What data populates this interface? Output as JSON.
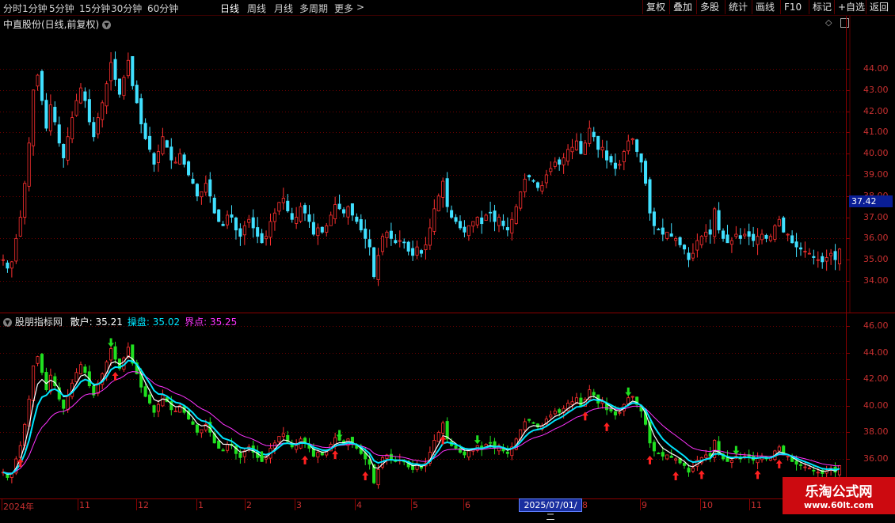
{
  "toolbar": {
    "periods": [
      "分时",
      "1分钟",
      "5分钟",
      "15分钟",
      "30分钟",
      "60分钟",
      "日线",
      "周线",
      "月线",
      "多周期",
      "更多"
    ],
    "active_period": "日线",
    "more_arrow": ">",
    "right_buttons": [
      "复权",
      "叠加",
      "多股",
      "统计",
      "画线",
      "F10",
      "标记",
      "+自选",
      "返回"
    ]
  },
  "main_chart": {
    "title": "中直股份(日线,前复权)",
    "y_ticks": [
      "44.00",
      "43.00",
      "42.00",
      "41.00",
      "40.00",
      "39.00",
      "38.00",
      "37.00",
      "36.00",
      "35.00",
      "34.00"
    ],
    "current_price": "37.42"
  },
  "indicator": {
    "name": "股朋指标网",
    "series": [
      {
        "label": "散户:",
        "value": "35.21",
        "color": "#ffffff"
      },
      {
        "label": "操盘:",
        "value": "35.02",
        "color": "#00e5ff"
      },
      {
        "label": "界点:",
        "value": "35.25",
        "color": "#ff33ff"
      }
    ],
    "y_ticks": [
      "46.00",
      "44.00",
      "42.00",
      "40.00",
      "38.00",
      "36.00"
    ]
  },
  "x_axis": {
    "labels": [
      "2024年",
      "11",
      "12",
      "1",
      "2",
      "3",
      "4",
      "5",
      "6",
      "7",
      "8",
      "9",
      "10",
      "11"
    ],
    "cursor_date": "2025/07/01/二"
  },
  "watermark": {
    "line1": "乐淘公式网",
    "line2": "www.60lt.com"
  },
  "colors": {
    "up": "#ff3030",
    "down": "#40e0ff",
    "grid": "#6e0000",
    "white_line": "#ffffff",
    "cyan_line": "#00e5ff",
    "magenta_line": "#ff33ff",
    "signal_up": "#ff2020",
    "signal_down": "#20e020"
  },
  "chart_data": {
    "type": "candlestick",
    "price_path": [
      35.0,
      34.6,
      34.9,
      36.0,
      37.0,
      38.6,
      40.5,
      43.0,
      43.7,
      42.5,
      41.2,
      42.3,
      41.5,
      40.5,
      39.8,
      40.8,
      41.7,
      42.5,
      43.1,
      42.5,
      41.5,
      40.8,
      41.7,
      42.4,
      43.3,
      44.3,
      43.5,
      42.8,
      43.6,
      44.4,
      43.2,
      42.4,
      41.4,
      40.7,
      40.2,
      39.5,
      40.1,
      40.8,
      40.3,
      39.7,
      39.6,
      40.0,
      39.5,
      39.0,
      38.6,
      38.0,
      38.2,
      38.6,
      38.0,
      37.2,
      36.8,
      36.6,
      37.1,
      37.0,
      36.4,
      36.1,
      36.6,
      36.9,
      36.5,
      36.1,
      35.8,
      36.1,
      36.8,
      37.2,
      37.7,
      37.9,
      37.3,
      36.9,
      37.0,
      37.5,
      37.2,
      36.8,
      36.2,
      36.5,
      36.3,
      36.6,
      37.1,
      37.6,
      37.4,
      37.2,
      37.5,
      37.1,
      36.8,
      36.4,
      36.0,
      35.6,
      34.2,
      35.2,
      36.1,
      36.3,
      36.0,
      35.8,
      35.9,
      35.8,
      35.4,
      35.2,
      35.6,
      35.3,
      35.7,
      36.5,
      37.4,
      38.0,
      38.7,
      37.5,
      37.0,
      36.8,
      36.5,
      36.3,
      36.6,
      36.8,
      37.0,
      36.7,
      37.1,
      37.2,
      36.8,
      37.0,
      36.6,
      36.4,
      36.9,
      37.5,
      38.2,
      38.8,
      38.9,
      38.7,
      38.4,
      38.5,
      39.0,
      39.3,
      39.6,
      39.5,
      39.8,
      40.2,
      40.3,
      40.6,
      40.0,
      40.5,
      41.2,
      40.8,
      40.2,
      40.3,
      39.7,
      39.6,
      39.3,
      39.5,
      40.1,
      40.6,
      40.7,
      40.1,
      39.6,
      38.6,
      37.2,
      36.6,
      36.4,
      36.2,
      36.3,
      36.1,
      36.0,
      35.7,
      35.5,
      35.0,
      35.3,
      35.9,
      36.1,
      36.3,
      36.2,
      37.4,
      36.4,
      36.0,
      35.8,
      35.9,
      36.2,
      36.0,
      36.2,
      36.1,
      35.9,
      36.1,
      36.2,
      36.0,
      36.1,
      36.6,
      36.9,
      36.3,
      36.2,
      35.8,
      35.6,
      35.5,
      35.4,
      35.3,
      35.1,
      35.0,
      34.9,
      35.1,
      35.3,
      35.0,
      35.5
    ],
    "last_price": 37.42,
    "indicator_latest": {
      "散户": 35.21,
      "操盘": 35.02,
      "界点": 35.25
    }
  }
}
